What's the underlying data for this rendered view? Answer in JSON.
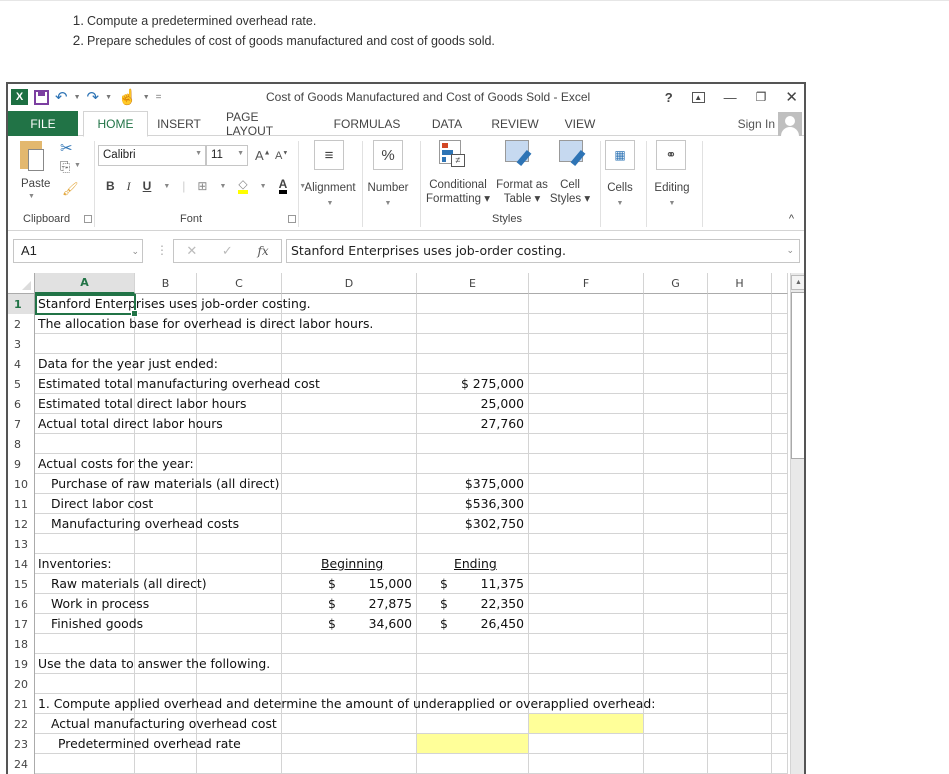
{
  "instructions": [
    {
      "num": "1.",
      "text": "Compute a predetermined overhead rate."
    },
    {
      "num": "2.",
      "text": "Prepare schedules of cost of goods manufactured and cost of goods sold."
    }
  ],
  "window": {
    "title": "Cost of Goods Manufactured and Cost of Goods Sold - Excel",
    "help": "?",
    "restore_ribbon": "⧉",
    "minimize": "—",
    "maximize": "🗗",
    "close": "✕"
  },
  "qat": {
    "logo": "X",
    "undo": "↶",
    "redo": "↷",
    "touch": "☝",
    "customize": "="
  },
  "tabs": [
    {
      "label": "FILE"
    },
    {
      "label": "HOME"
    },
    {
      "label": "INSERT"
    },
    {
      "label": "PAGE LAYOUT"
    },
    {
      "label": "FORMULAS"
    },
    {
      "label": "DATA"
    },
    {
      "label": "REVIEW"
    },
    {
      "label": "VIEW"
    }
  ],
  "account": {
    "sign_in": "Sign In"
  },
  "ribbon": {
    "clipboard": {
      "paste": "Paste",
      "group": "Clipboard"
    },
    "font": {
      "name": "Calibri",
      "size": "11",
      "bold": "B",
      "italic": "I",
      "underline": "U",
      "group": "Font",
      "grow": "A",
      "shrink": "A",
      "font_color": "A"
    },
    "alignment": {
      "label": "Alignment",
      "icon": "≡"
    },
    "number": {
      "label": "Number",
      "icon": "%"
    },
    "styles": {
      "conditional": [
        "Conditional",
        "Formatting ▾"
      ],
      "format_table": [
        "Format as",
        "Table ▾"
      ],
      "cell_styles": [
        "Cell",
        "Styles ▾"
      ],
      "group": "Styles"
    },
    "cells": {
      "label": "Cells"
    },
    "editing": {
      "label": "Editing"
    }
  },
  "formula_bar": {
    "name_box": "A1",
    "cancel": "✕",
    "enter": "✓",
    "fx": "fx",
    "value": "Stanford Enterprises uses job-order costing."
  },
  "columns": [
    "A",
    "B",
    "C",
    "D",
    "E",
    "F",
    "G",
    "H"
  ],
  "rows": [
    {
      "n": "1",
      "a": "Stanford Enterprises uses job-order costing."
    },
    {
      "n": "2",
      "a": "The allocation base for overhead is direct labor hours."
    },
    {
      "n": "3"
    },
    {
      "n": "4",
      "a": "Data for the year just ended:"
    },
    {
      "n": "5",
      "a": "Estimated total manufacturing overhead cost",
      "e": "$ 275,000"
    },
    {
      "n": "6",
      "a": "Estimated total direct labor hours",
      "e": "25,000"
    },
    {
      "n": "7",
      "a": "Actual total direct labor hours",
      "e": "27,760"
    },
    {
      "n": "8"
    },
    {
      "n": "9",
      "a": "Actual costs for the year:"
    },
    {
      "n": "10",
      "a2": "Purchase of raw materials (all direct)",
      "e": "$375,000"
    },
    {
      "n": "11",
      "a2": "Direct labor cost",
      "e": "$536,300"
    },
    {
      "n": "12",
      "a2": "Manufacturing overhead costs",
      "e": "$302,750"
    },
    {
      "n": "13"
    },
    {
      "n": "14",
      "a": "Inventories:",
      "d_head": "Beginning",
      "e_head": "Ending"
    },
    {
      "n": "15",
      "a2": "Raw materials (all direct)",
      "d_cur": "$",
      "d_val": "15,000",
      "e_cur": "$",
      "e_val": "11,375"
    },
    {
      "n": "16",
      "a2": "Work in process",
      "d_cur": "$",
      "d_val": "27,875",
      "e_cur": "$",
      "e_val": "22,350"
    },
    {
      "n": "17",
      "a2": "Finished goods",
      "d_cur": "$",
      "d_val": "34,600",
      "e_cur": "$",
      "e_val": "26,450"
    },
    {
      "n": "18"
    },
    {
      "n": "19",
      "a": "Use the data to answer the following."
    },
    {
      "n": "20"
    },
    {
      "n": "21",
      "a": "1. Compute applied overhead and determine the amount of underapplied or overapplied overhead:"
    },
    {
      "n": "22",
      "a2": "Actual manufacturing overhead cost"
    },
    {
      "n": "23",
      "a3": "Predetermined overhead rate"
    },
    {
      "n": "24"
    }
  ],
  "highlight_color": "#ffff99",
  "accent_color": "#217346"
}
